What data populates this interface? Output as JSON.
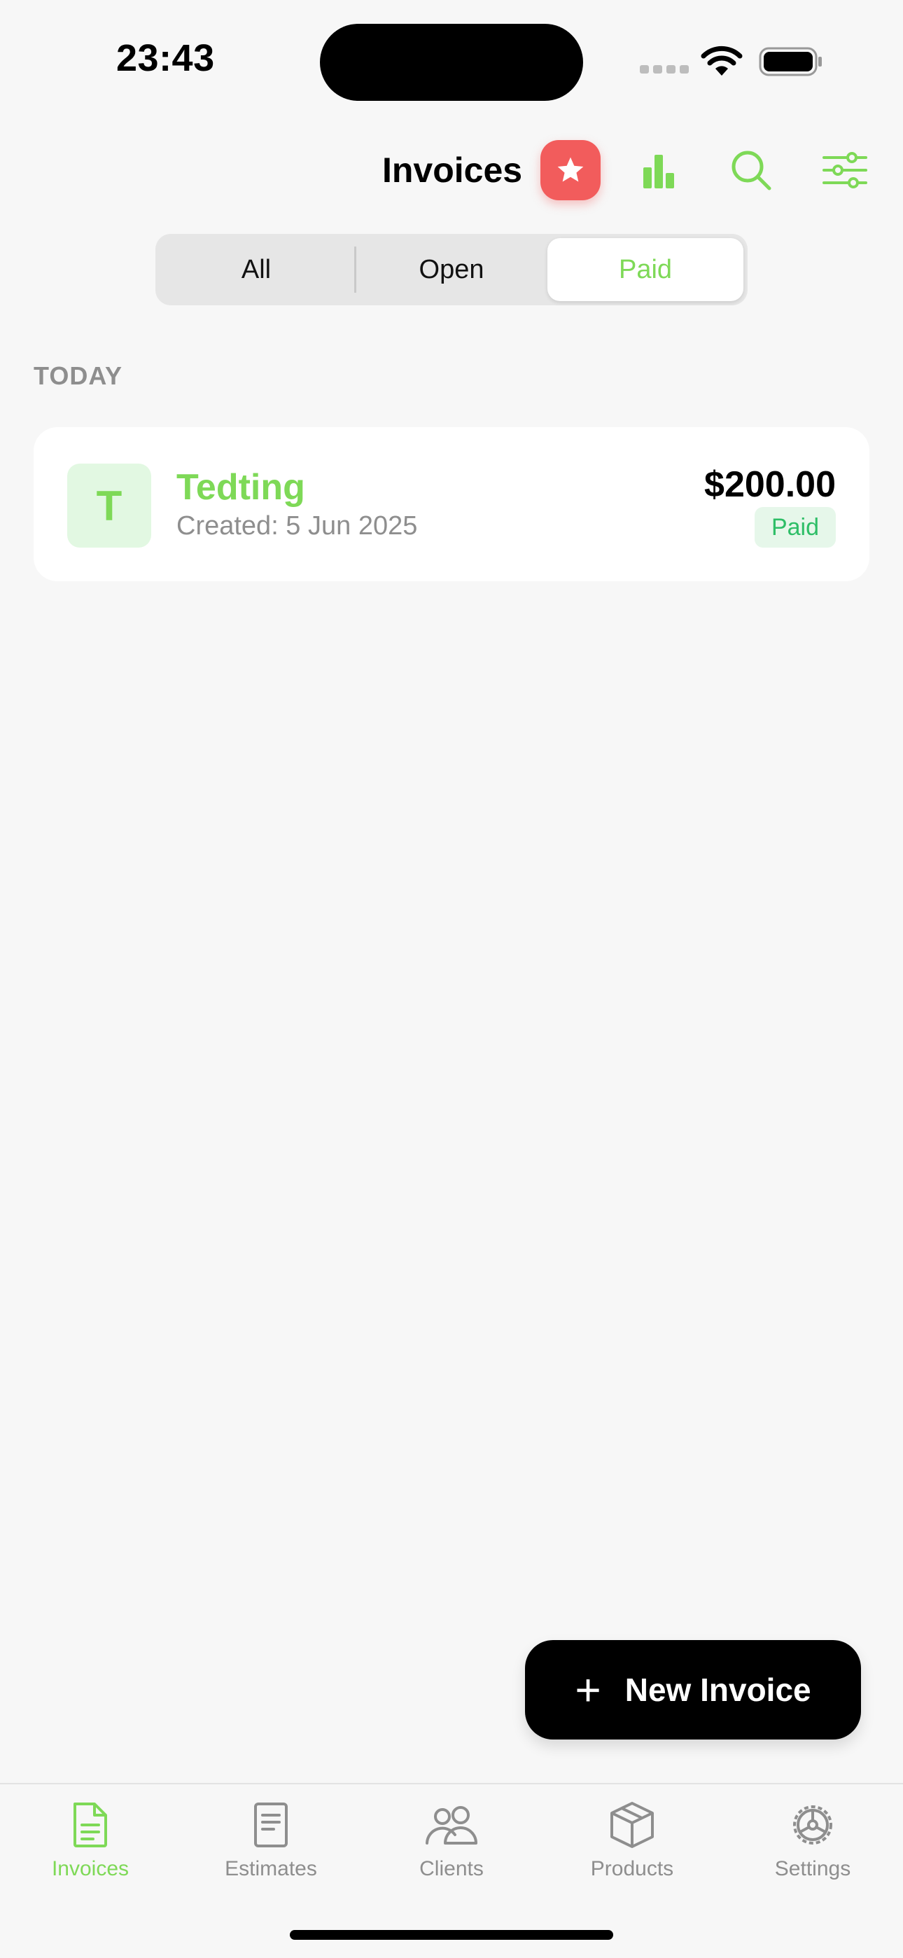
{
  "status_bar": {
    "time": "23:43"
  },
  "header": {
    "title": "Invoices",
    "icons": [
      "star-icon",
      "bar-chart-icon",
      "search-icon",
      "filter-sliders-icon"
    ]
  },
  "segmented": {
    "tabs": [
      "All",
      "Open",
      "Paid"
    ],
    "selected": "Paid"
  },
  "section": {
    "label": "TODAY"
  },
  "invoices": [
    {
      "avatar_letter": "T",
      "client": "Tedting",
      "created": "Created: 5 Jun 2025",
      "amount": "$200.00",
      "status": "Paid"
    }
  ],
  "fab": {
    "label": "New Invoice",
    "icon": "plus-icon"
  },
  "tabbar": {
    "items": [
      {
        "label": "Invoices",
        "icon": "document-icon",
        "active": true
      },
      {
        "label": "Estimates",
        "icon": "estimate-icon",
        "active": false
      },
      {
        "label": "Clients",
        "icon": "people-icon",
        "active": false
      },
      {
        "label": "Products",
        "icon": "box-icon",
        "active": false
      },
      {
        "label": "Settings",
        "icon": "gear-icon",
        "active": false
      }
    ]
  },
  "colors": {
    "accent": "#7ED957",
    "star_badge": "#F25C5C",
    "paid_text": "#2EBE67",
    "paid_bg": "#E6F7EA",
    "background": "#F7F7F7"
  }
}
